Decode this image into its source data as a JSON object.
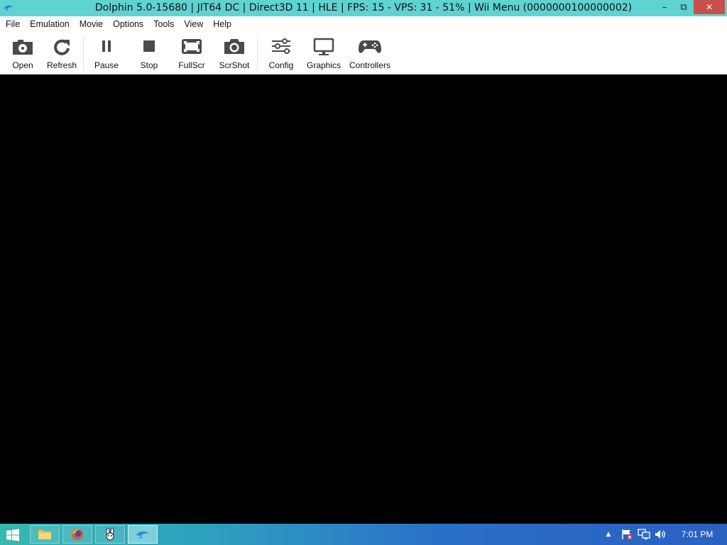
{
  "window": {
    "title": "Dolphin 5.0-15680 | JIT64 DC | Direct3D 11 | HLE | FPS: 15 - VPS: 31 - 51% | Wii Menu (0000000100000002)",
    "minimize_glyph": "–",
    "restore_glyph": "⧉",
    "close_glyph": "✕",
    "accent_color": "#5fd3d1"
  },
  "menu": {
    "items": [
      {
        "label": "File"
      },
      {
        "label": "Emulation"
      },
      {
        "label": "Movie"
      },
      {
        "label": "Options"
      },
      {
        "label": "Tools"
      },
      {
        "label": "View"
      },
      {
        "label": "Help"
      }
    ]
  },
  "toolbar": {
    "buttons": [
      {
        "label": "Open",
        "icon": "open-icon"
      },
      {
        "label": "Refresh",
        "icon": "refresh-icon"
      },
      {
        "label": "Pause",
        "icon": "pause-icon"
      },
      {
        "label": "Stop",
        "icon": "stop-icon"
      },
      {
        "label": "FullScr",
        "icon": "fullscreen-icon"
      },
      {
        "label": "ScrShot",
        "icon": "camera-icon"
      },
      {
        "label": "Config",
        "icon": "sliders-icon"
      },
      {
        "label": "Graphics",
        "icon": "monitor-icon"
      },
      {
        "label": "Controllers",
        "icon": "gamepad-icon"
      }
    ]
  },
  "taskbar": {
    "clock": "7:01 PM",
    "apps": [
      {
        "name": "file-explorer",
        "icon": "folder-icon"
      },
      {
        "name": "firefox",
        "icon": "firefox-icon"
      },
      {
        "name": "app-3",
        "icon": "bunny-icon"
      },
      {
        "name": "dolphin",
        "icon": "dolphin-icon",
        "active": true
      }
    ],
    "tray": {
      "show_hidden_glyph": "▲",
      "volume_glyph": "🔊"
    }
  }
}
